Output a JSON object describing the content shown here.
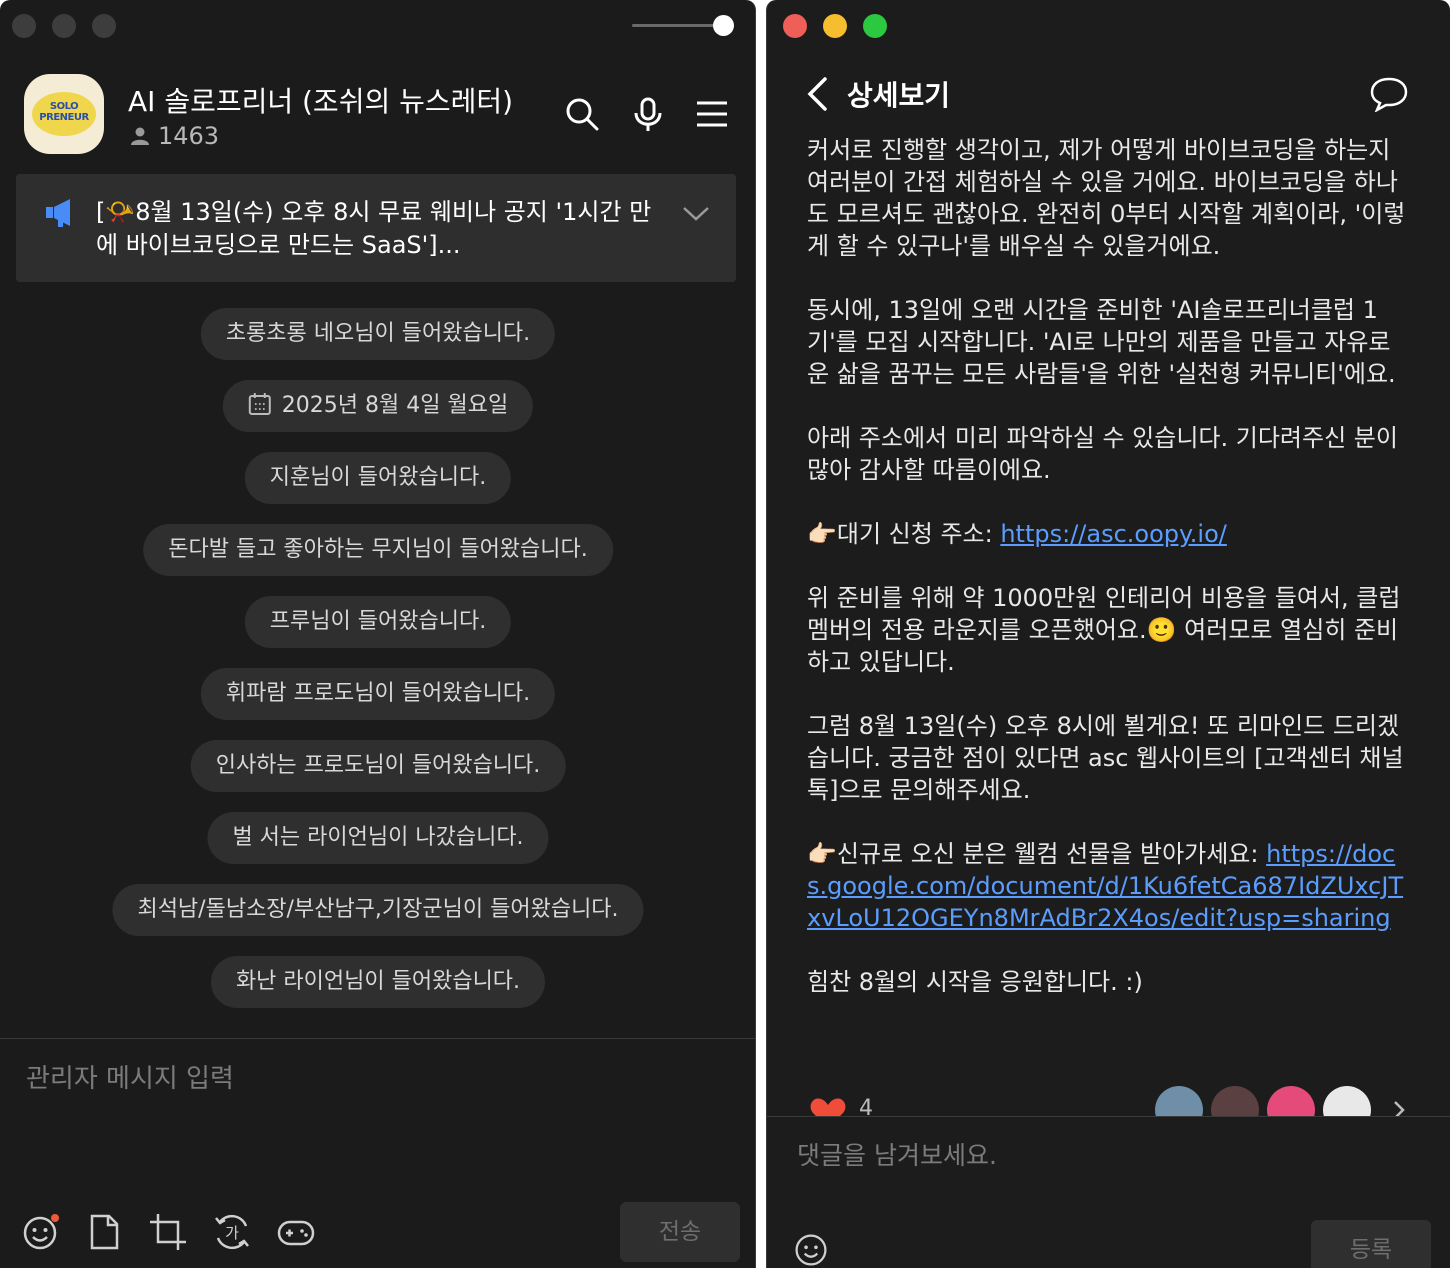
{
  "left": {
    "channel": {
      "title": "AI 솔로프리너 (조쉬의 뉴스레터)",
      "member_count": "1463",
      "logo_line1": "SOLO",
      "logo_line2": "PRENEUR"
    },
    "notice": {
      "text": "[📯8월 13일(수) 오후 8시 무료 웨비나 공지 '1시간 만에 바이브코딩으로 만드는 SaaS']..."
    },
    "messages": [
      {
        "text": "초롱초롱 네오님이 들어왔습니다."
      },
      {
        "text": "2025년 8월 4일 월요일",
        "type": "date"
      },
      {
        "text": "지훈님이 들어왔습니다."
      },
      {
        "text": "돈다발 들고 좋아하는 무지님이 들어왔습니다."
      },
      {
        "text": "프루님이 들어왔습니다."
      },
      {
        "text": "휘파람 프로도님이 들어왔습니다."
      },
      {
        "text": "인사하는 프로도님이 들어왔습니다."
      },
      {
        "text": "벌 서는 라이언님이 나갔습니다."
      },
      {
        "text": "최석남/돌남소장/부산남구,기장군님이 들어왔습니다."
      },
      {
        "text": "화난 라이언님이 들어왔습니다."
      }
    ],
    "input": {
      "placeholder": "관리자 메시지 입력"
    },
    "send_label": "전송"
  },
  "right": {
    "title": "상세보기",
    "paragraphs": [
      "커서로 진행할 생각이고, 제가 어떻게 바이브코딩을 하는지 여러분이 간접 체험하실 수 있을 거에요. 바이브코딩을 하나도 모르셔도 괜찮아요. 완전히 0부터 시작할 계획이라, '이렇게 할 수 있구나'를 배우실 수 있을거에요.",
      "동시에, 13일에 오랜 시간을 준비한 'AI솔로프리너클럽 1기'를 모집 시작합니다. 'AI로 나만의 제품을 만들고 자유로운 삶을 꿈꾸는 모든 사람들'을 위한 '실천형 커뮤니티'에요.",
      "아래 주소에서 미리 파악하실 수 있습니다. 기다려주신 분이 많아 감사할 따름이에요."
    ],
    "waitlist_prefix": "👉🏻대기 신청 주소: ",
    "waitlist_link": "https://asc.oopy.io/",
    "lounge_before": "위 준비를 위해 약 1000만원 인테리어 비용을 들여서, 클럽 멤버의 전용 라운지를 오픈했어요.",
    "lounge_emoji": "🙂",
    "lounge_after": " 여러모로 열심히 준비하고 있답니다.",
    "reminder": "그럼 8월 13일(수) 오후 8시에 뵐게요! 또 리마인드 드리겠습니다. 궁금한 점이 있다면 asc 웹사이트의 [고객센터 채널톡]으로 문의해주세요.",
    "gift_prefix": "👉🏻신규로 오신 분은 웰컴 선물을 받아가세요: ",
    "gift_link": "https://docs.google.com/document/d/1Ku6fetCa687IdZUxcJTxvLoU12OGEYn8MrAdBr2X4os/edit?usp=sharing",
    "closing": "힘찬 8월의 시작을 응원합니다. :)",
    "like_count": "4",
    "comment_placeholder": "댓글을 남겨보세요.",
    "register_label": "등록"
  }
}
